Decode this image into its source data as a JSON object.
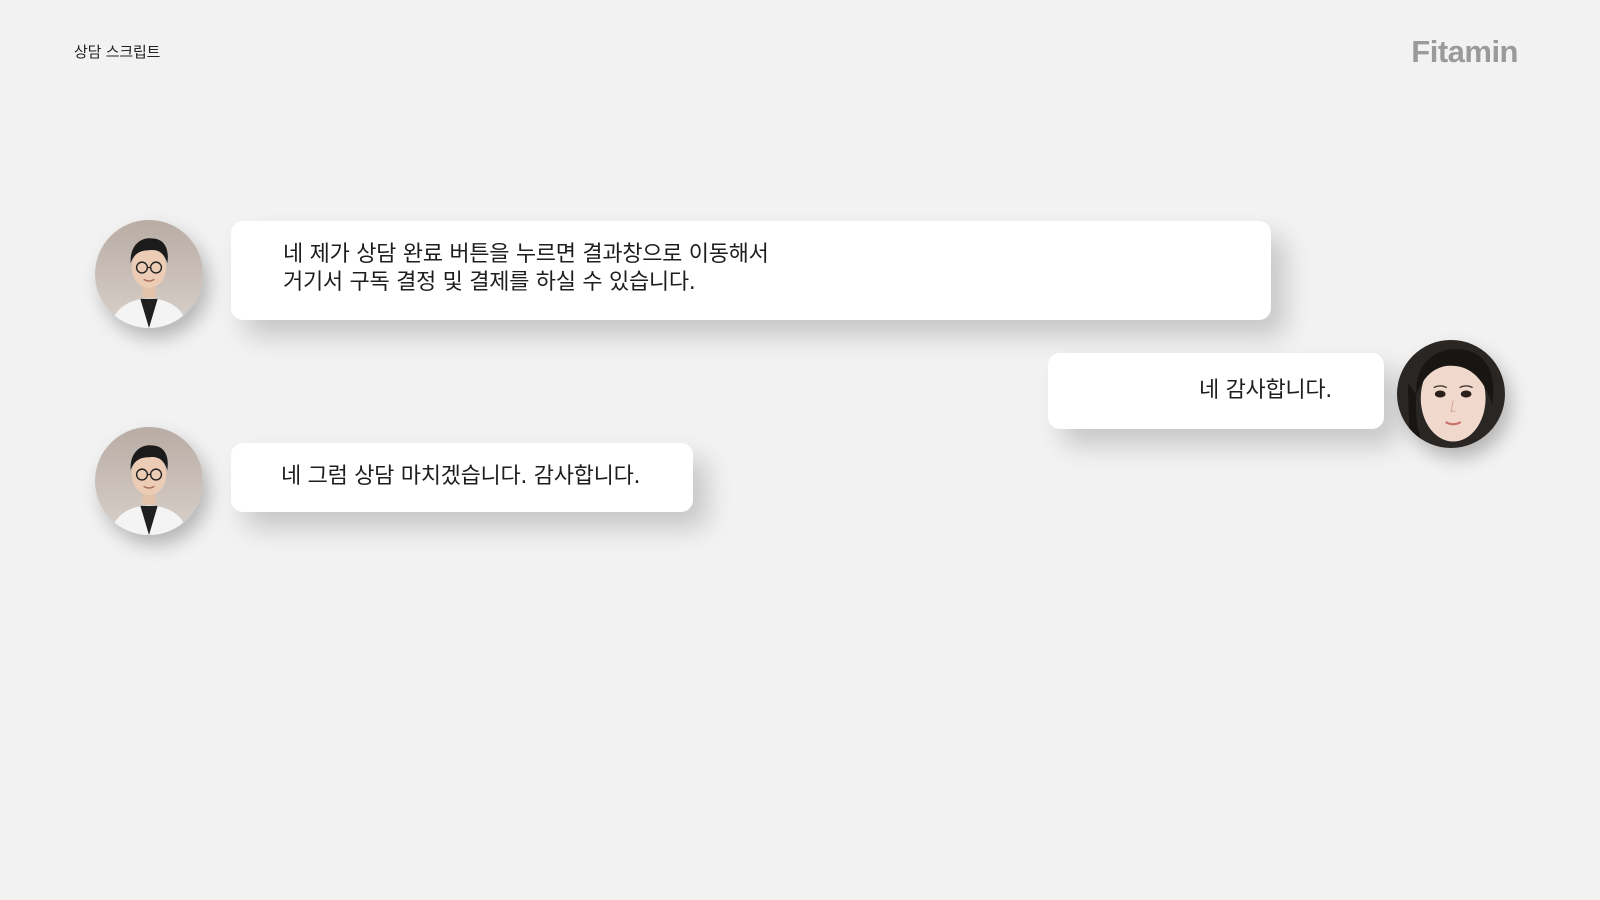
{
  "header": {
    "page_label": "상담 스크립트",
    "brand_logo": "Fitamin"
  },
  "messages": [
    {
      "speaker": "counselor",
      "avatar": "counselor-photo",
      "lines": [
        "네 제가 상담 완료 버튼을 누르면 결과창으로 이동해서",
        "거기서 구독 결정 및 결제를 하실 수 있습니다."
      ]
    },
    {
      "speaker": "customer",
      "avatar": "customer-photo",
      "lines": [
        "네 감사합니다."
      ]
    },
    {
      "speaker": "counselor",
      "avatar": "counselor-photo",
      "lines": [
        "네 그럼 상담 마치겠습니다. 감사합니다."
      ]
    }
  ],
  "colors": {
    "background": "#f2f2f2",
    "bubble": "#ffffff",
    "logo": "#9a9a9a",
    "text": "#1e1e1e"
  }
}
